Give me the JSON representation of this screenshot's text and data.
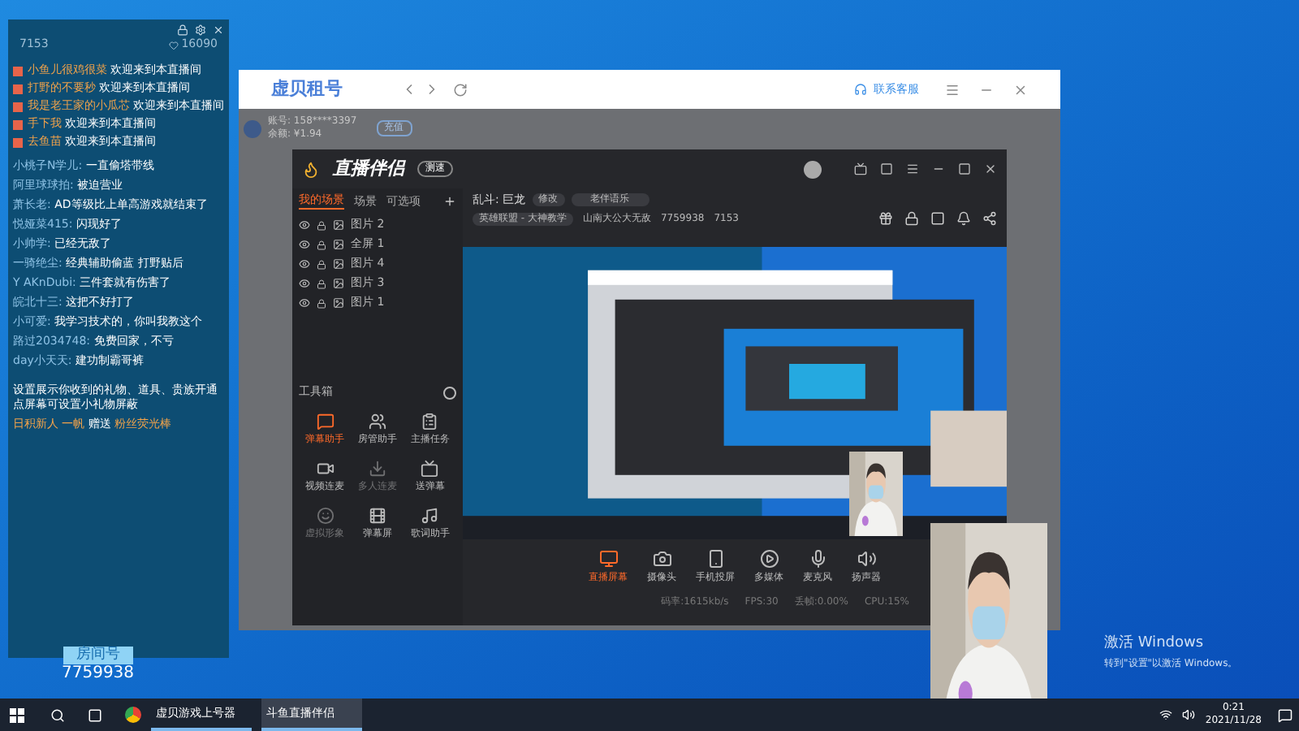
{
  "chat_panel": {
    "stats": [
      "7153",
      "16090"
    ],
    "welcomes": [
      {
        "user": "小鱼儿很鸡很菜",
        "text": "欢迎来到本直播间"
      },
      {
        "user": "打野的不要秒",
        "text": "欢迎来到本直播间"
      },
      {
        "user": "我是老王家的小瓜芯",
        "text": "欢迎来到本直播间"
      },
      {
        "user": "手下我",
        "text": "欢迎来到本直播间"
      },
      {
        "user": "去鱼苗",
        "text": "欢迎来到本直播间"
      }
    ],
    "messages": [
      {
        "user": "小桃子N学儿:",
        "text": "一直偷塔带线"
      },
      {
        "user": "阿里球球拍:",
        "text": "被迫营业"
      },
      {
        "user": "萧长老:",
        "text": "AD等级比上单高游戏就结束了"
      },
      {
        "user": "悦娅菜415:",
        "text": "闪现好了"
      },
      {
        "user": "小帅学:",
        "text": "已经无敌了"
      },
      {
        "user": "一骑绝尘:",
        "text": "经典辅助偷蓝 打野贴后"
      },
      {
        "user": "Y AKnDubi:",
        "text": "三件套就有伤害了"
      },
      {
        "user": "皖北十三:",
        "text": "这把不好打了"
      },
      {
        "user": "小可爱:",
        "text": "我学习技术的，你叫我教这个"
      },
      {
        "user": "路过2034748:",
        "text": "免费回家，不亏"
      },
      {
        "user": "day小天天:",
        "text": "建功制霸哥裤"
      }
    ],
    "notice": [
      "设置展示你收到的礼物、道具、贵族开通",
      "点屏幕可设置小礼物屏蔽"
    ],
    "gift": {
      "user": "日积新人 一帆",
      "verb": "赠送",
      "item": "粉丝荧光棒"
    },
    "room_label": "房间号",
    "room_number": "7759938"
  },
  "browser": {
    "title": "虚贝租号",
    "support": "联系客服",
    "account": "账号: 158****3397",
    "balance": "余额: ¥1.94",
    "recharge": "充值"
  },
  "studio": {
    "title": "直播伴侣",
    "badge": "测速",
    "scene_tabs": [
      {
        "label": "我的场景",
        "selected": true
      },
      {
        "label": "场景",
        "selected": false
      },
      {
        "label": "可选项",
        "selected": false
      }
    ],
    "sources": [
      "图片 2",
      "全屏 1",
      "图片 4",
      "图片 3",
      "图片 1"
    ],
    "toolbox_title": "工具箱",
    "tools": [
      {
        "label": "弹幕助手",
        "disabled": false,
        "accent": true
      },
      {
        "label": "房管助手",
        "disabled": false,
        "accent": false
      },
      {
        "label": "主播任务",
        "disabled": false,
        "accent": false
      },
      {
        "label": "视频连麦",
        "disabled": false,
        "accent": false
      },
      {
        "label": "多人连麦",
        "disabled": true,
        "accent": false
      },
      {
        "label": "送弹幕",
        "disabled": false,
        "accent": false
      },
      {
        "label": "虚拟形象",
        "disabled": true,
        "accent": false
      },
      {
        "label": "弹幕屏",
        "disabled": false,
        "accent": false
      },
      {
        "label": "歌词助手",
        "disabled": false,
        "accent": false
      }
    ],
    "mode": "乱斗: 巨龙",
    "edit": "修改",
    "tagline": "老伴语乐",
    "category": "英雄联盟 - 大神教学",
    "streamer": "山南大公大无敌",
    "room": "7759938",
    "fans": "7153",
    "controls": [
      {
        "label": "直播屏幕",
        "selected": true
      },
      {
        "label": "摄像头",
        "selected": false
      },
      {
        "label": "手机投屏",
        "selected": false
      },
      {
        "label": "多媒体",
        "selected": false
      },
      {
        "label": "麦克风",
        "selected": false
      },
      {
        "label": "扬声器",
        "selected": false
      }
    ],
    "status": [
      "码率:1615kb/s",
      "FPS:30",
      "丢帧:0.00%",
      "CPU:15%"
    ]
  },
  "watermark_notice": {
    "title": "激活 Windows",
    "text": "转到\"设置\"以激活 Windows。"
  },
  "taskbar": {
    "apps": [
      {
        "label": "虚贝游戏上号器",
        "selected": false
      },
      {
        "label": "斗鱼直播伴侣",
        "selected": true
      }
    ],
    "time": "0:21",
    "date": "2021/11/28"
  }
}
